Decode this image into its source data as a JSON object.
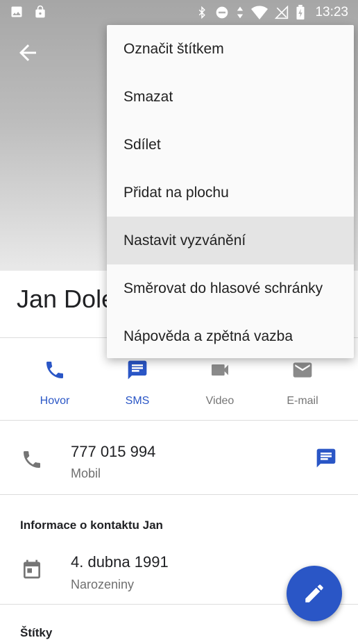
{
  "status_bar": {
    "time": "13:23",
    "left_icons": [
      "image-icon",
      "lock-icon"
    ],
    "right_icons": [
      "bluetooth-icon",
      "dnd-icon",
      "data-arrows-icon",
      "wifi-icon",
      "no-signal-icon",
      "battery-charging-icon"
    ]
  },
  "contact": {
    "name": "Jan Dole"
  },
  "actions": [
    {
      "label": "Hovor",
      "icon": "phone-icon",
      "color": "#2a56c6"
    },
    {
      "label": "SMS",
      "icon": "message-icon",
      "color": "#2a56c6"
    },
    {
      "label": "Video",
      "icon": "video-icon",
      "color": "#8a8a8a"
    },
    {
      "label": "E-mail",
      "icon": "email-icon",
      "color": "#8a8a8a"
    }
  ],
  "phone": {
    "number": "777 015 994",
    "type": "Mobil"
  },
  "info": {
    "title": "Informace o kontaktu Jan",
    "birthday": {
      "date": "4. dubna 1991",
      "label": "Narozeniny"
    }
  },
  "tags_title": "Štítky",
  "menu": {
    "items": [
      "Označit štítkem",
      "Smazat",
      "Sdílet",
      "Přidat na plochu",
      "Nastavit vyzvánění",
      "Směrovat do hlasové schránky",
      "Nápověda a zpětná vazba"
    ],
    "highlighted": 4
  },
  "colors": {
    "accent": "#2a56c6",
    "fab": "#2a56c6"
  }
}
